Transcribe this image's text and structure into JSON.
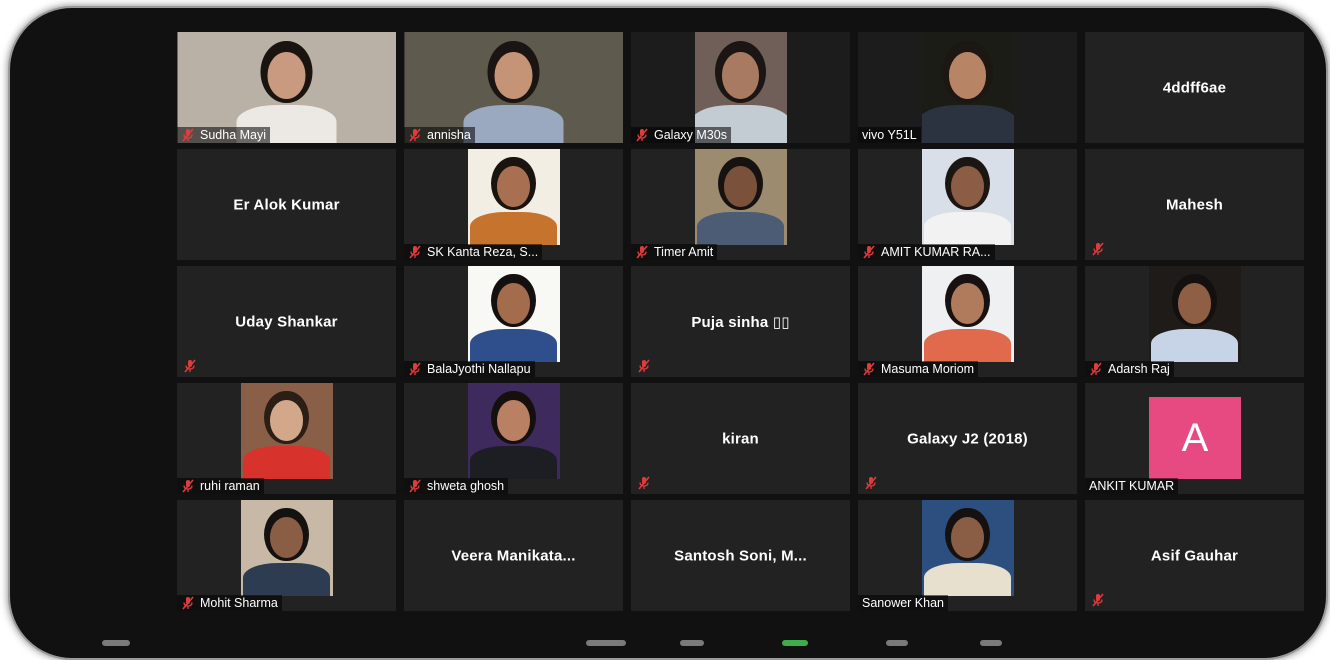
{
  "participants": [
    {
      "name": "Sudha Mayi",
      "type": "video",
      "muted": true,
      "bg": "#b9b1a6",
      "skin": "#c99a80",
      "hair": "#1a1410",
      "shirt": "#ece9e4"
    },
    {
      "name": "annisha",
      "type": "video",
      "muted": true,
      "bg": "#5e5a4e",
      "skin": "#c59376",
      "hair": "#1a1512",
      "shirt": "#9aa9c0"
    },
    {
      "name": "Galaxy M30s",
      "type": "video",
      "narrow": true,
      "muted": true,
      "bg": "#6f5f58",
      "skin": "#a87a62",
      "hair": "#1b1614",
      "shirt": "#c3cbd3"
    },
    {
      "name": "vivo Y51L",
      "type": "video",
      "narrow": true,
      "muted": false,
      "bg": "#1b1c16",
      "skin": "#b88466",
      "hair": "#1c1712",
      "shirt": "#2b3340"
    },
    {
      "name": "4ddff6ae",
      "type": "name-only",
      "muted": false,
      "show_label": false
    },
    {
      "name": "Er Alok Kumar",
      "type": "name-only",
      "muted": false,
      "show_label": false
    },
    {
      "name": "SK Kanta Reza, S...",
      "type": "photo",
      "muted": true,
      "bg": "#f3eee4",
      "skin": "#a87050",
      "hair": "#1a1410",
      "shirt": "#c6732e"
    },
    {
      "name": "Timer Amit",
      "type": "photo",
      "muted": true,
      "bg": "#9c8b6f",
      "skin": "#7a523b",
      "hair": "#151211",
      "shirt": "#4c5c74"
    },
    {
      "name": "AMIT KUMAR RA...",
      "type": "photo",
      "muted": true,
      "bg": "#d9dfe8",
      "skin": "#8a5d44",
      "hair": "#1c1613",
      "shirt": "#f2f2f2"
    },
    {
      "name": "Mahesh",
      "type": "name-only",
      "muted": true,
      "show_label": false
    },
    {
      "name": "Uday Shankar",
      "type": "name-only",
      "muted": true,
      "show_label": false
    },
    {
      "name": "BalaJyothi Nallapu",
      "type": "photo",
      "muted": true,
      "bg": "#f8f8f4",
      "skin": "#a26c4d",
      "hair": "#141010",
      "shirt": "#2f4f8c"
    },
    {
      "name": "Puja  sinha ▯▯",
      "type": "name-only",
      "muted": true,
      "show_label": false
    },
    {
      "name": "Masuma Moriom",
      "type": "photo",
      "muted": true,
      "bg": "#eef0f2",
      "skin": "#b07a5c",
      "hair": "#171210",
      "shirt": "#e26a4c"
    },
    {
      "name": "Adarsh Raj",
      "type": "photo",
      "muted": true,
      "bg": "#1f1b18",
      "skin": "#8e5f45",
      "hair": "#141010",
      "shirt": "#c7d3e6"
    },
    {
      "name": "ruhi raman",
      "type": "photo",
      "muted": true,
      "bg": "#8a5f48",
      "skin": "#d3a88a",
      "hair": "#2a1e17",
      "shirt": "#d8322c"
    },
    {
      "name": "shweta ghosh",
      "type": "photo",
      "muted": true,
      "bg": "#3f2a5e",
      "skin": "#b98064",
      "hair": "#15100e",
      "shirt": "#1d1d24"
    },
    {
      "name": "kiran",
      "type": "name-only",
      "muted": true,
      "show_label": false
    },
    {
      "name": "Galaxy J2 (2018)",
      "type": "name-only",
      "muted": true,
      "show_label": false
    },
    {
      "name": "ANKIT KUMAR",
      "type": "avatar",
      "muted": false,
      "letter": "A",
      "color": "#e64a81"
    },
    {
      "name": "Mohit Sharma",
      "type": "photo",
      "muted": true,
      "bg": "#c8b9a7",
      "skin": "#8a5e45",
      "hair": "#151110",
      "shirt": "#2e3c52"
    },
    {
      "name": "Veera  Manikata...",
      "type": "name-only",
      "muted": false,
      "show_label": false
    },
    {
      "name": "Santosh  Soni,  M...",
      "type": "name-only",
      "muted": false,
      "show_label": false
    },
    {
      "name": "Sanower Khan",
      "type": "photo",
      "muted": false,
      "bg": "#2d4f7f",
      "skin": "#8a5e45",
      "hair": "#151110",
      "shirt": "#e8e0cf"
    },
    {
      "name": "Asif Gauhar",
      "type": "name-only",
      "muted": true,
      "show_label": false
    }
  ],
  "colors": {
    "muted_icon": "#e23b3b",
    "tile_bg": "#222222",
    "frame_bg": "#111111"
  }
}
